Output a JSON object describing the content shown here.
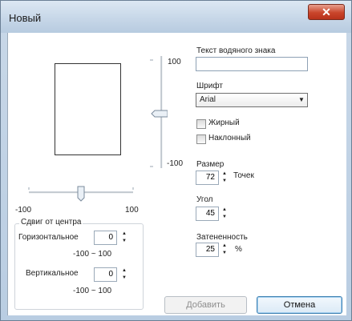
{
  "window": {
    "title": "Новый",
    "close_icon": "close-icon"
  },
  "vertical_slider": {
    "max_label": "100",
    "min_label": "-100"
  },
  "horizontal_slider": {
    "min_label": "-100",
    "max_label": "100"
  },
  "offset_group": {
    "title": "Сдвиг от центра",
    "horizontal_label": "Горизонтальное",
    "horizontal_value": "0",
    "horizontal_range": "-100 ~ 100",
    "vertical_label": "Вертикальное",
    "vertical_value": "0",
    "vertical_range": "-100 ~ 100"
  },
  "watermark": {
    "text_label": "Текст водяного знака",
    "text_value": "",
    "font_label": "Шрифт",
    "font_value": "Arial",
    "bold_label": "Жирный",
    "italic_label": "Наклонный",
    "size_label": "Размер",
    "size_value": "72",
    "size_unit": "Точек",
    "angle_label": "Угол",
    "angle_value": "45",
    "shade_label": "Затененность",
    "shade_value": "25",
    "shade_unit": "%"
  },
  "buttons": {
    "add": "Добавить",
    "cancel": "Отмена"
  }
}
